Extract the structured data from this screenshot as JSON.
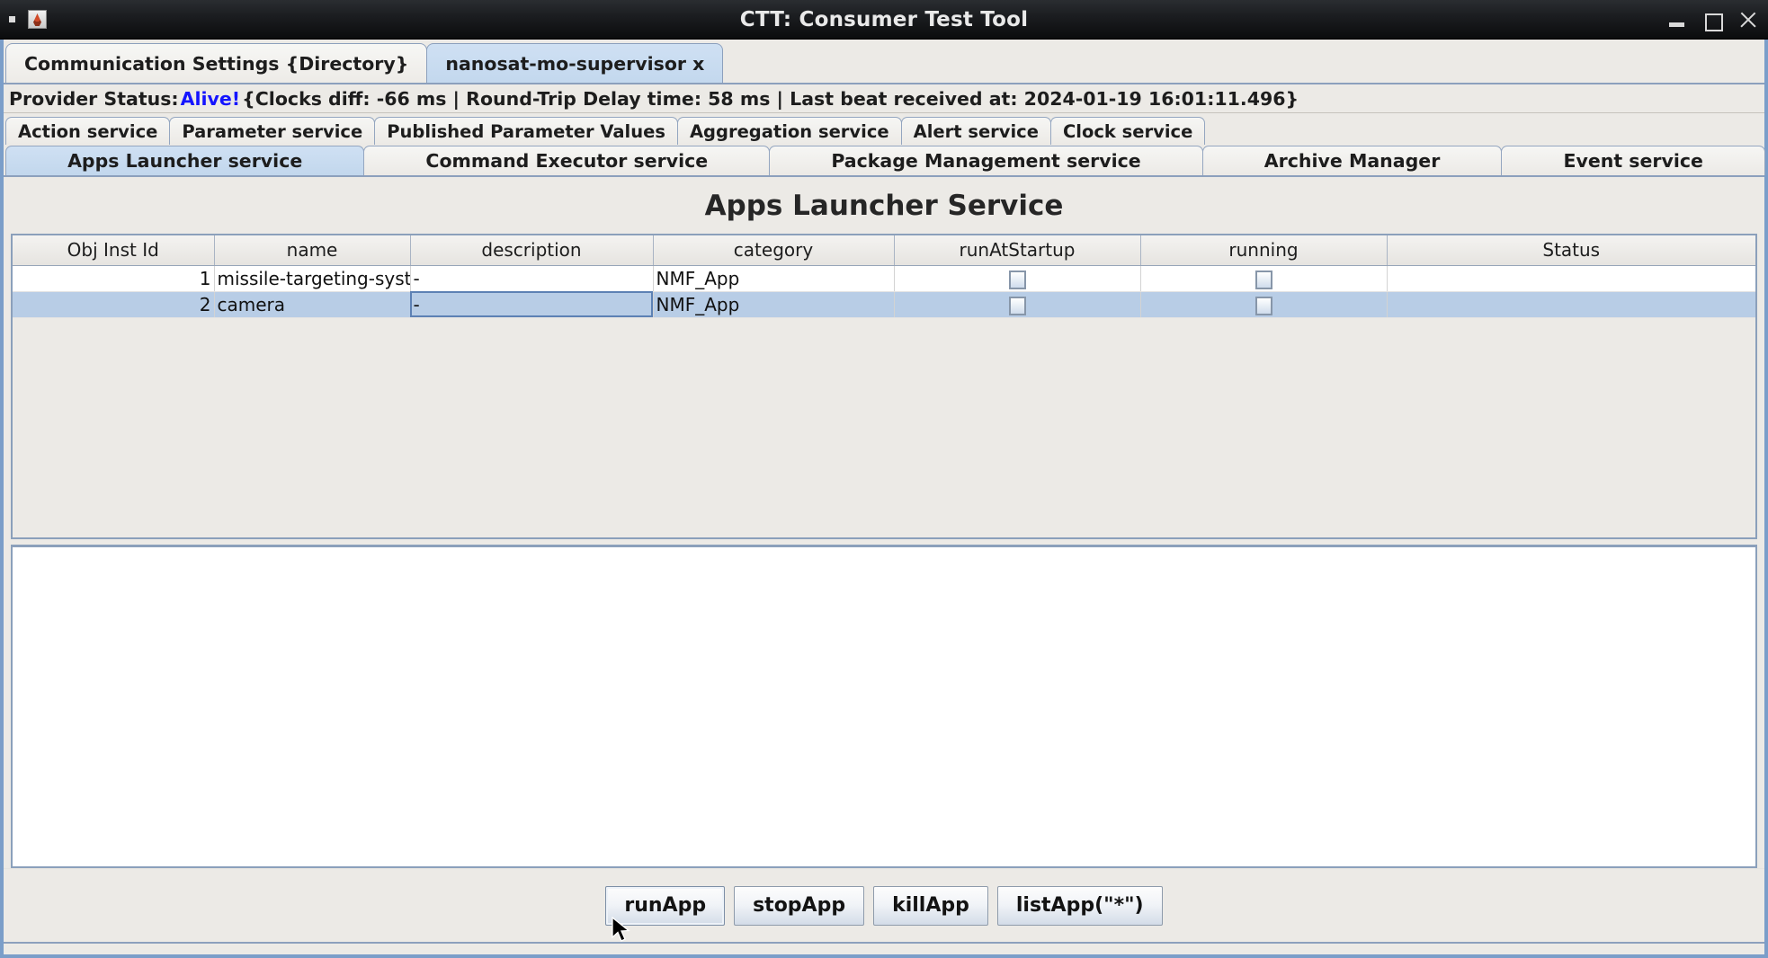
{
  "window": {
    "title": "CTT: Consumer Test Tool",
    "icon": "app-icon",
    "controls": {
      "minimize": "—",
      "maximize": "□",
      "close": "✕"
    }
  },
  "top_tabs": [
    {
      "label": "Communication Settings {Directory}",
      "selected": false
    },
    {
      "label": "nanosat-mo-supervisor x",
      "selected": true
    }
  ],
  "status": {
    "prefix": "Provider Status:",
    "state": "Alive!",
    "state_color": "#1414ff",
    "details": "{Clocks diff: -66 ms | Round-Trip Delay time: 58 ms | Last beat received at: 2024-01-19 16:01:11.496}",
    "clocks_diff": "-66 ms",
    "round_trip_delay": "58 ms",
    "last_beat": "2024-01-19 16:01:11.496"
  },
  "service_tabs_row1": [
    {
      "label": "Action service",
      "selected": false
    },
    {
      "label": "Parameter service",
      "selected": false
    },
    {
      "label": "Published Parameter Values",
      "selected": false
    },
    {
      "label": "Aggregation service",
      "selected": false
    },
    {
      "label": "Alert service",
      "selected": false
    },
    {
      "label": "Clock service",
      "selected": false
    }
  ],
  "service_tabs_row2": [
    {
      "label": "Apps Launcher service",
      "selected": true
    },
    {
      "label": "Command Executor service",
      "selected": false
    },
    {
      "label": "Package Management service",
      "selected": false
    },
    {
      "label": "Archive Manager",
      "selected": false
    },
    {
      "label": "Event service",
      "selected": false
    }
  ],
  "panel": {
    "title": "Apps Launcher Service"
  },
  "table": {
    "columns": [
      "Obj Inst Id",
      "name",
      "description",
      "category",
      "runAtStartup",
      "running",
      "Status"
    ],
    "rows": [
      {
        "obj_inst_id": "1",
        "name": "missile-targeting-syst...",
        "description": "-",
        "category": "NMF_App",
        "run_at_startup": false,
        "running": false,
        "status": "",
        "selected": false,
        "focus_cell": null
      },
      {
        "obj_inst_id": "2",
        "name": "camera",
        "description": "-",
        "category": "NMF_App",
        "run_at_startup": false,
        "running": false,
        "status": "",
        "selected": true,
        "focus_cell": "description"
      }
    ]
  },
  "output_area": {
    "value": "",
    "placeholder": ""
  },
  "buttons": [
    {
      "label": "runApp",
      "focused": true
    },
    {
      "label": "stopApp",
      "focused": false
    },
    {
      "label": "killApp",
      "focused": false
    },
    {
      "label": "listApp(\"*\")",
      "focused": false
    }
  ],
  "colors": {
    "window_border": "#7b9ec9",
    "selected_tab": "#c9dcf0",
    "selected_row": "#b8cde6",
    "panel_bg": "#eceae6",
    "titlebar": "#17191c"
  }
}
